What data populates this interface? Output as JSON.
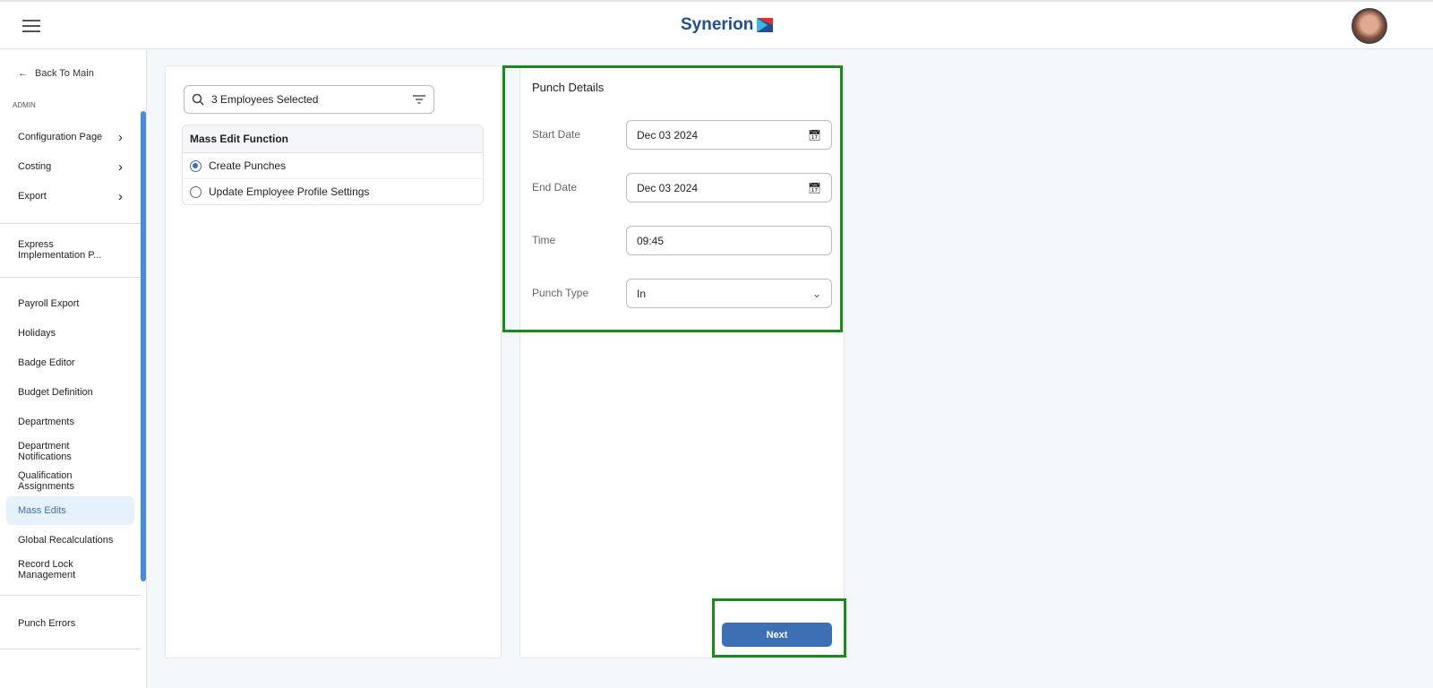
{
  "header": {
    "logo": "Synerion"
  },
  "sidebar": {
    "back": "Back To Main",
    "section": "ADMIN",
    "items": [
      {
        "label": "Configuration Page",
        "arrow": true
      },
      {
        "label": "Costing",
        "arrow": true
      },
      {
        "label": "Export",
        "arrow": true
      },
      {
        "label": "Express Implementation P..."
      },
      {
        "label": "Payroll Export"
      },
      {
        "label": "Holidays"
      },
      {
        "label": "Badge Editor"
      },
      {
        "label": "Budget Definition"
      },
      {
        "label": "Departments"
      },
      {
        "label": "Department Notifications"
      },
      {
        "label": "Qualification Assignments"
      },
      {
        "label": "Mass Edits",
        "active": true
      },
      {
        "label": "Global Recalculations"
      },
      {
        "label": "Record Lock Management"
      },
      {
        "label": "Punch Errors"
      }
    ]
  },
  "left": {
    "search_value": "3 Employees Selected",
    "function_header": "Mass Edit Function",
    "options": [
      {
        "label": "Create Punches",
        "selected": true
      },
      {
        "label": "Update Employee Profile Settings",
        "selected": false
      }
    ]
  },
  "punch": {
    "title": "Punch Details",
    "start_label": "Start Date",
    "start_value": "Dec 03 2024",
    "end_label": "End Date",
    "end_value": "Dec 03 2024",
    "time_label": "Time",
    "time_value": "09:45",
    "type_label": "Punch Type",
    "type_value": "In"
  },
  "next_label": "Next"
}
